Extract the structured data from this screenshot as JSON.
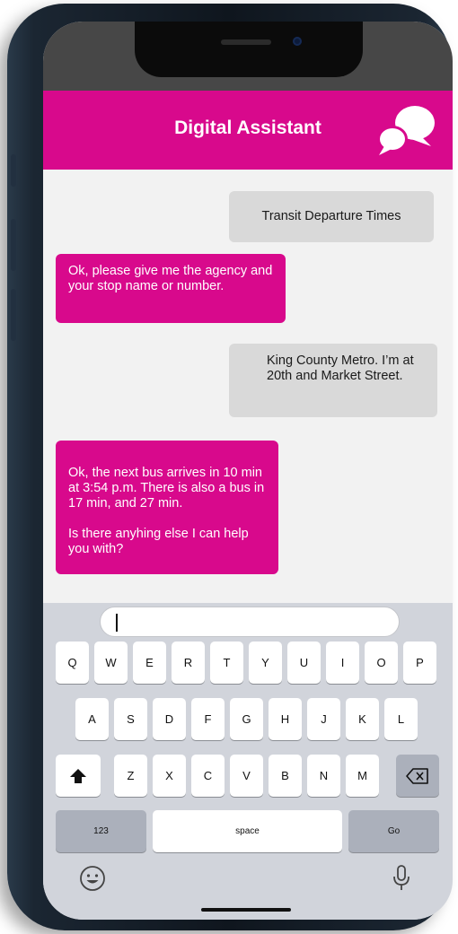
{
  "header": {
    "title": "Digital Assistant",
    "accent_color": "#d8098c",
    "icon": "chat-bubbles-icon"
  },
  "messages": [
    {
      "from": "user",
      "text": "Transit Departure Times"
    },
    {
      "from": "assistant",
      "text": "Ok, please give me the agency and your stop name or number."
    },
    {
      "from": "user",
      "text": "King County Metro. I’m at 20th and Market Street."
    },
    {
      "from": "assistant",
      "text": "Ok, the next bus arrives in 10 min at 3:54 p.m. There is also a bus in 17 min, and 27 min.\n\nIs there anyhing else I can help you with?"
    }
  ],
  "input": {
    "value": ""
  },
  "keyboard": {
    "row1": [
      "Q",
      "W",
      "E",
      "R",
      "T",
      "Y",
      "U",
      "I",
      "O",
      "P"
    ],
    "row2": [
      "A",
      "S",
      "D",
      "F",
      "G",
      "H",
      "J",
      "K",
      "L"
    ],
    "row3": [
      "Z",
      "X",
      "C",
      "V",
      "B",
      "N",
      "M"
    ],
    "numbers_label": "123",
    "space_label": "space",
    "go_label": "Go",
    "shift_icon": "shift-icon",
    "backspace_icon": "backspace-icon",
    "emoji_icon": "emoji-icon",
    "mic_icon": "microphone-icon"
  }
}
